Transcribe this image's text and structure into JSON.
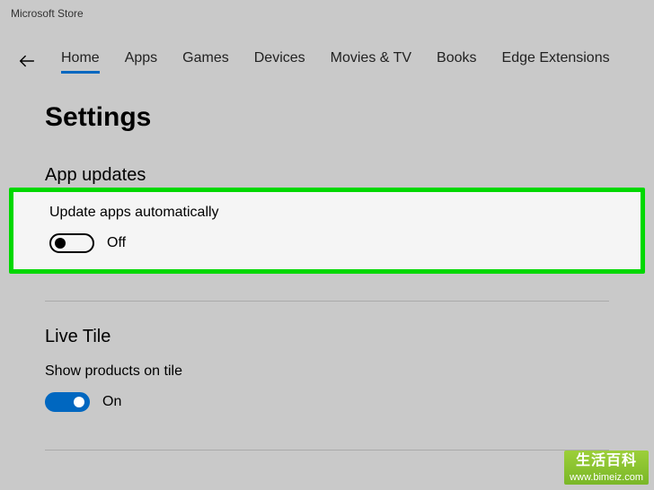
{
  "window": {
    "title": "Microsoft Store"
  },
  "nav": {
    "tabs": [
      "Home",
      "Apps",
      "Games",
      "Devices",
      "Movies & TV",
      "Books",
      "Edge Extensions"
    ],
    "active": "Home"
  },
  "page": {
    "title": "Settings"
  },
  "sections": {
    "app_updates": {
      "heading": "App updates",
      "update_auto_label": "Update apps automatically",
      "update_auto_state": "Off",
      "update_auto_on": false
    },
    "live_tile": {
      "heading": "Live Tile",
      "show_products_label": "Show products on tile",
      "show_products_state": "On",
      "show_products_on": true
    }
  },
  "watermark": {
    "line1": "生活百科",
    "line2": "www.bimeiz.com"
  }
}
